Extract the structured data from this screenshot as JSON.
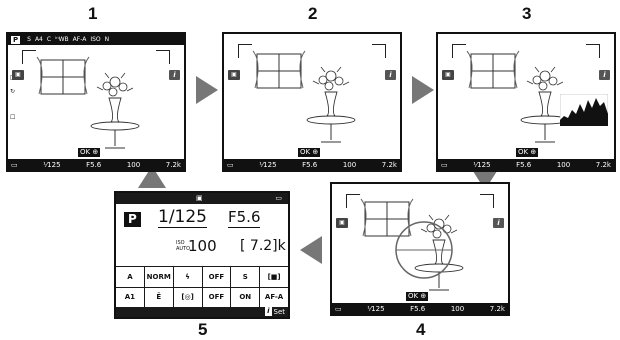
{
  "panels": [
    {
      "number": "1"
    },
    {
      "number": "2"
    },
    {
      "number": "3"
    },
    {
      "number": "4"
    },
    {
      "number": "5"
    }
  ],
  "screen1": {
    "mode": "P",
    "top_items": [
      "S",
      "A4",
      "C",
      "ᴵⁿWB",
      "AF-A",
      "ISO",
      "N"
    ],
    "left_items": [
      "□",
      "↻",
      "☐"
    ],
    "shutter": "¹⁄125",
    "aperture": "F5.6",
    "iso": "100",
    "frames": "7.2k"
  },
  "screen2": {
    "shutter": "¹⁄125",
    "aperture": "F5.6",
    "iso": "100",
    "frames": "7.2k"
  },
  "screen3": {
    "shutter": "¹⁄125",
    "aperture": "F5.6",
    "iso": "100",
    "frames": "7.2k"
  },
  "screen4": {
    "shutter": "¹⁄125",
    "aperture": "F5.6",
    "iso": "100",
    "frames": "7.2k"
  },
  "common": {
    "ok_label": "OK",
    "i_label": "i"
  },
  "info": {
    "mode": "P",
    "shutter": "1/125",
    "aperture": "F5.6",
    "iso_label": "ISO AUTO",
    "iso": "100",
    "frames": "[ 7.2]k",
    "grid": [
      "A",
      "NORM",
      "ϟ",
      "OFF",
      "S",
      "[■]",
      "A1",
      "Ē",
      "[◎]",
      "OFF",
      "ON",
      "AF-A"
    ],
    "footer_i": "i",
    "footer_label": "Set"
  }
}
